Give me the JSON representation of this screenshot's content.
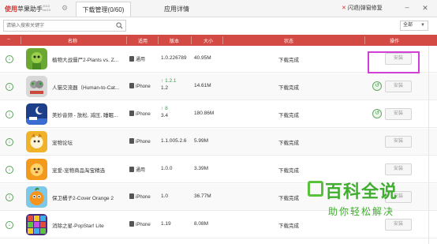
{
  "titlebar": {
    "brand_red": "使用",
    "brand_rest": "苹果助手",
    "version_lines": "2013 ver10",
    "tabs": [
      {
        "label": "下载管理(0/60)",
        "active": true
      },
      {
        "label": "应用详情",
        "active": false
      }
    ],
    "fix_label": "闪退|弹窗修复",
    "minimize": "–",
    "close": "✕"
  },
  "search": {
    "placeholder": "请输入搜索关键字",
    "filter_value": "全部"
  },
  "table": {
    "headers": {
      "name": "名称",
      "device": "适用",
      "version": "版本",
      "size": "大小",
      "status": "状态",
      "action": "操作"
    },
    "rows": [
      {
        "name": "植物大战僵尸2-Plants vs. Z...",
        "device": "通用",
        "version": "1.0.226789",
        "size": "40.95M",
        "status": "下载完成",
        "button": "安装",
        "ok": false
      },
      {
        "name": "人猫交流器（Human-to-Cat...",
        "device": "iPhone",
        "version_new": "1.2.1",
        "version": "1.2",
        "size": "14.61M",
        "status": "下载完成",
        "button": "安装",
        "ok": true
      },
      {
        "name": "美妙音频 - 放松, 减压, 睡眠...",
        "device": "iPhone",
        "version_new": "8",
        "version": "3.4",
        "size": "180.86M",
        "status": "下载完成",
        "button": "安装",
        "ok": true
      },
      {
        "name": "宠物论坛",
        "device": "iPhone",
        "version": "1.1.005.2.6",
        "size": "5.99M",
        "status": "下载完成",
        "button": "安装",
        "ok": false
      },
      {
        "name": "宠爱-宠物商品淘宝精选",
        "device": "通用",
        "version": "1.0.0",
        "size": "3.39M",
        "status": "下载完成",
        "button": "安装",
        "ok": false
      },
      {
        "name": "保卫橘子2-Cover Orange 2",
        "device": "iPhone",
        "version": "1.0",
        "size": "36.77M",
        "status": "下载完成",
        "button": "安装",
        "ok": false
      },
      {
        "name": "消除之星-PopStar! Lite",
        "device": "iPhone",
        "version": "1.19",
        "size": "8.08M",
        "status": "下载完成",
        "button": "安装",
        "ok": false
      }
    ]
  },
  "watermark": {
    "title": "百科全说",
    "subtitle": "助你轻松解决"
  },
  "colors": {
    "header_red": "#d24a43",
    "highlight": "#d23fd6",
    "watermark_green": "#3fae2e"
  }
}
